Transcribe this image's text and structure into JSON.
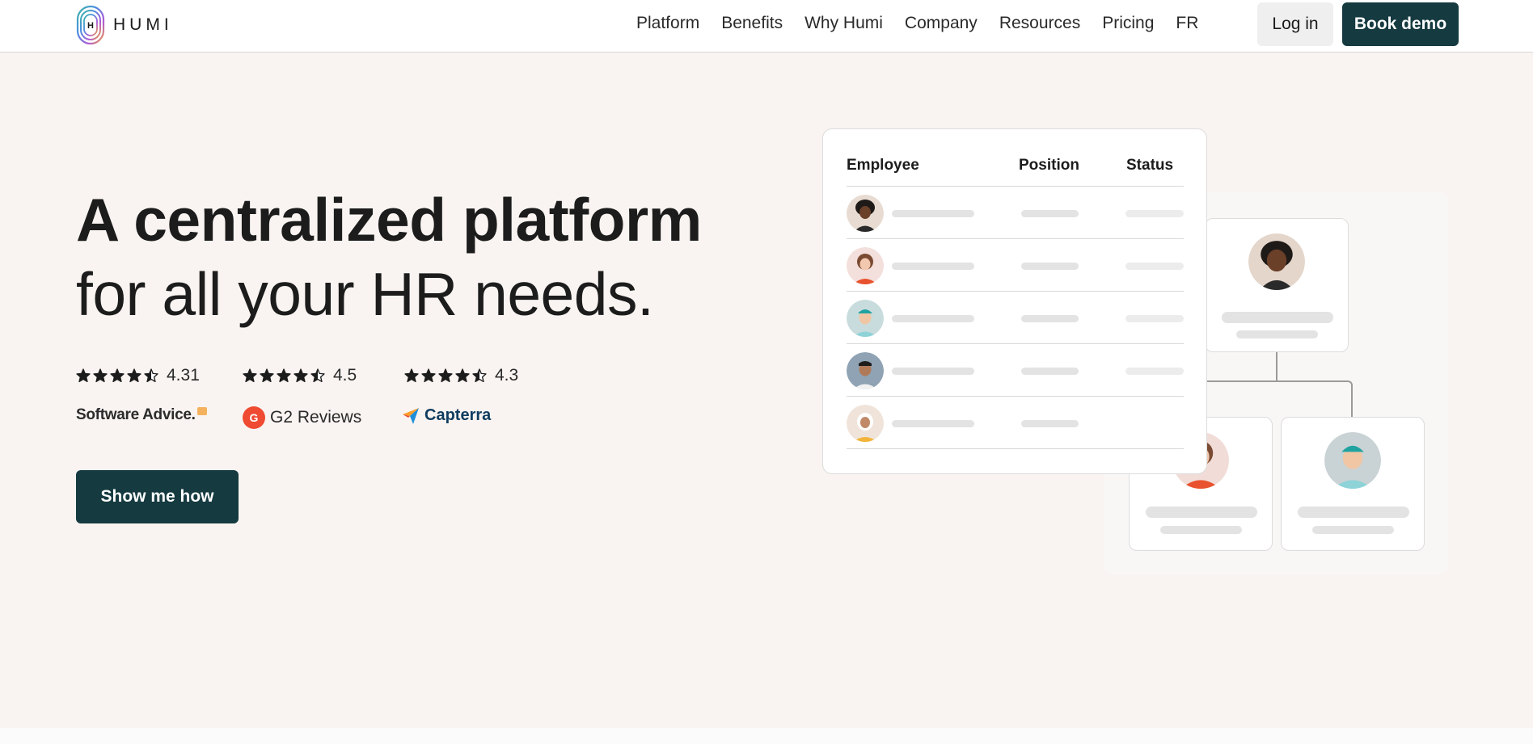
{
  "header": {
    "logo_text": "HUMI",
    "nav": [
      "Platform",
      "Benefits",
      "Why Humi",
      "Company",
      "Resources",
      "Pricing",
      "FR"
    ],
    "login_label": "Log in",
    "demo_label": "Book demo"
  },
  "hero": {
    "headline_line1": "A centralized platform",
    "headline_line2": "for all your HR needs.",
    "cta_label": "Show me how"
  },
  "ratings": [
    {
      "score": "4.31",
      "source": "Software Advice.",
      "stars": 4.5
    },
    {
      "score": "4.5",
      "source": "G2 Reviews",
      "badge": "G",
      "stars": 4.5
    },
    {
      "score": "4.3",
      "source": "Capterra",
      "stars": 4.5
    }
  ],
  "table": {
    "headers": [
      "Employee",
      "Position",
      "Status"
    ]
  },
  "colors": {
    "primary": "#153a40",
    "background": "#f9f4f1",
    "star": "#1c1c1c"
  }
}
